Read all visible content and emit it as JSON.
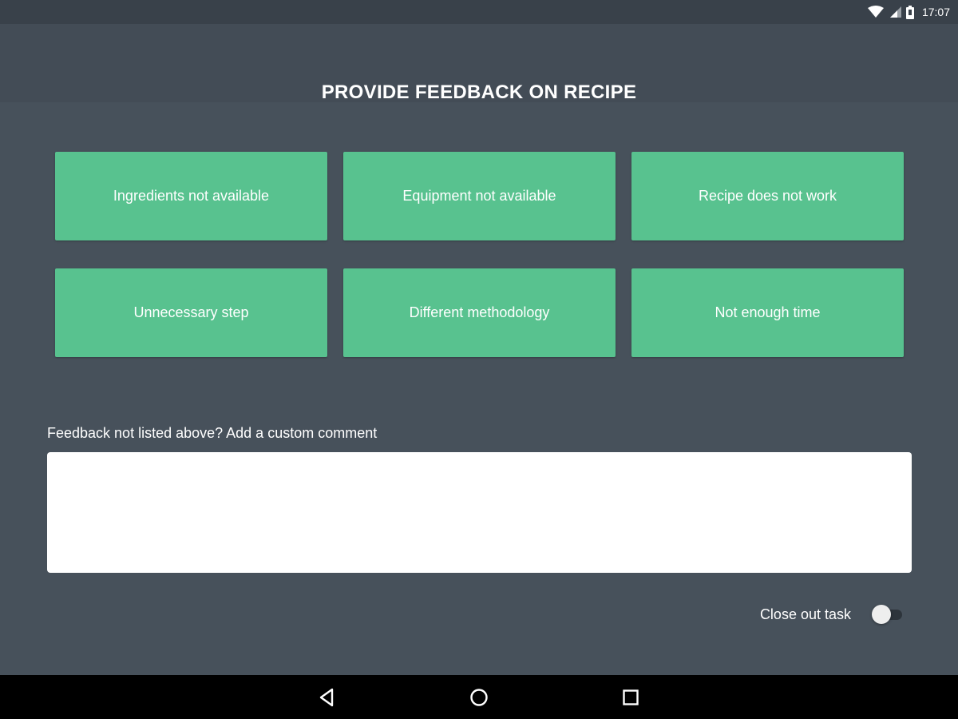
{
  "status_bar": {
    "time": "17:07",
    "icons": [
      "wifi-icon",
      "signal-icon",
      "battery-icon"
    ]
  },
  "dialog": {
    "title": "PROVIDE FEEDBACK ON RECIPE",
    "options": [
      {
        "label": "Ingredients not available"
      },
      {
        "label": "Equipment not available"
      },
      {
        "label": "Recipe does not work"
      },
      {
        "label": "Unnecessary step"
      },
      {
        "label": "Different methodology"
      },
      {
        "label": "Not enough time"
      }
    ],
    "comment_label": "Feedback not listed above? Add a custom comment",
    "comment_value": "",
    "close_out_label": "Close out task",
    "close_out_enabled": false
  },
  "nav_bar": {
    "buttons": [
      "back-icon",
      "home-icon",
      "recents-icon"
    ]
  },
  "colors": {
    "background": "#47515b",
    "accent_green": "#58c28f",
    "text": "#ffffff",
    "status_bar": "#39414a",
    "nav_bar": "#000000"
  }
}
